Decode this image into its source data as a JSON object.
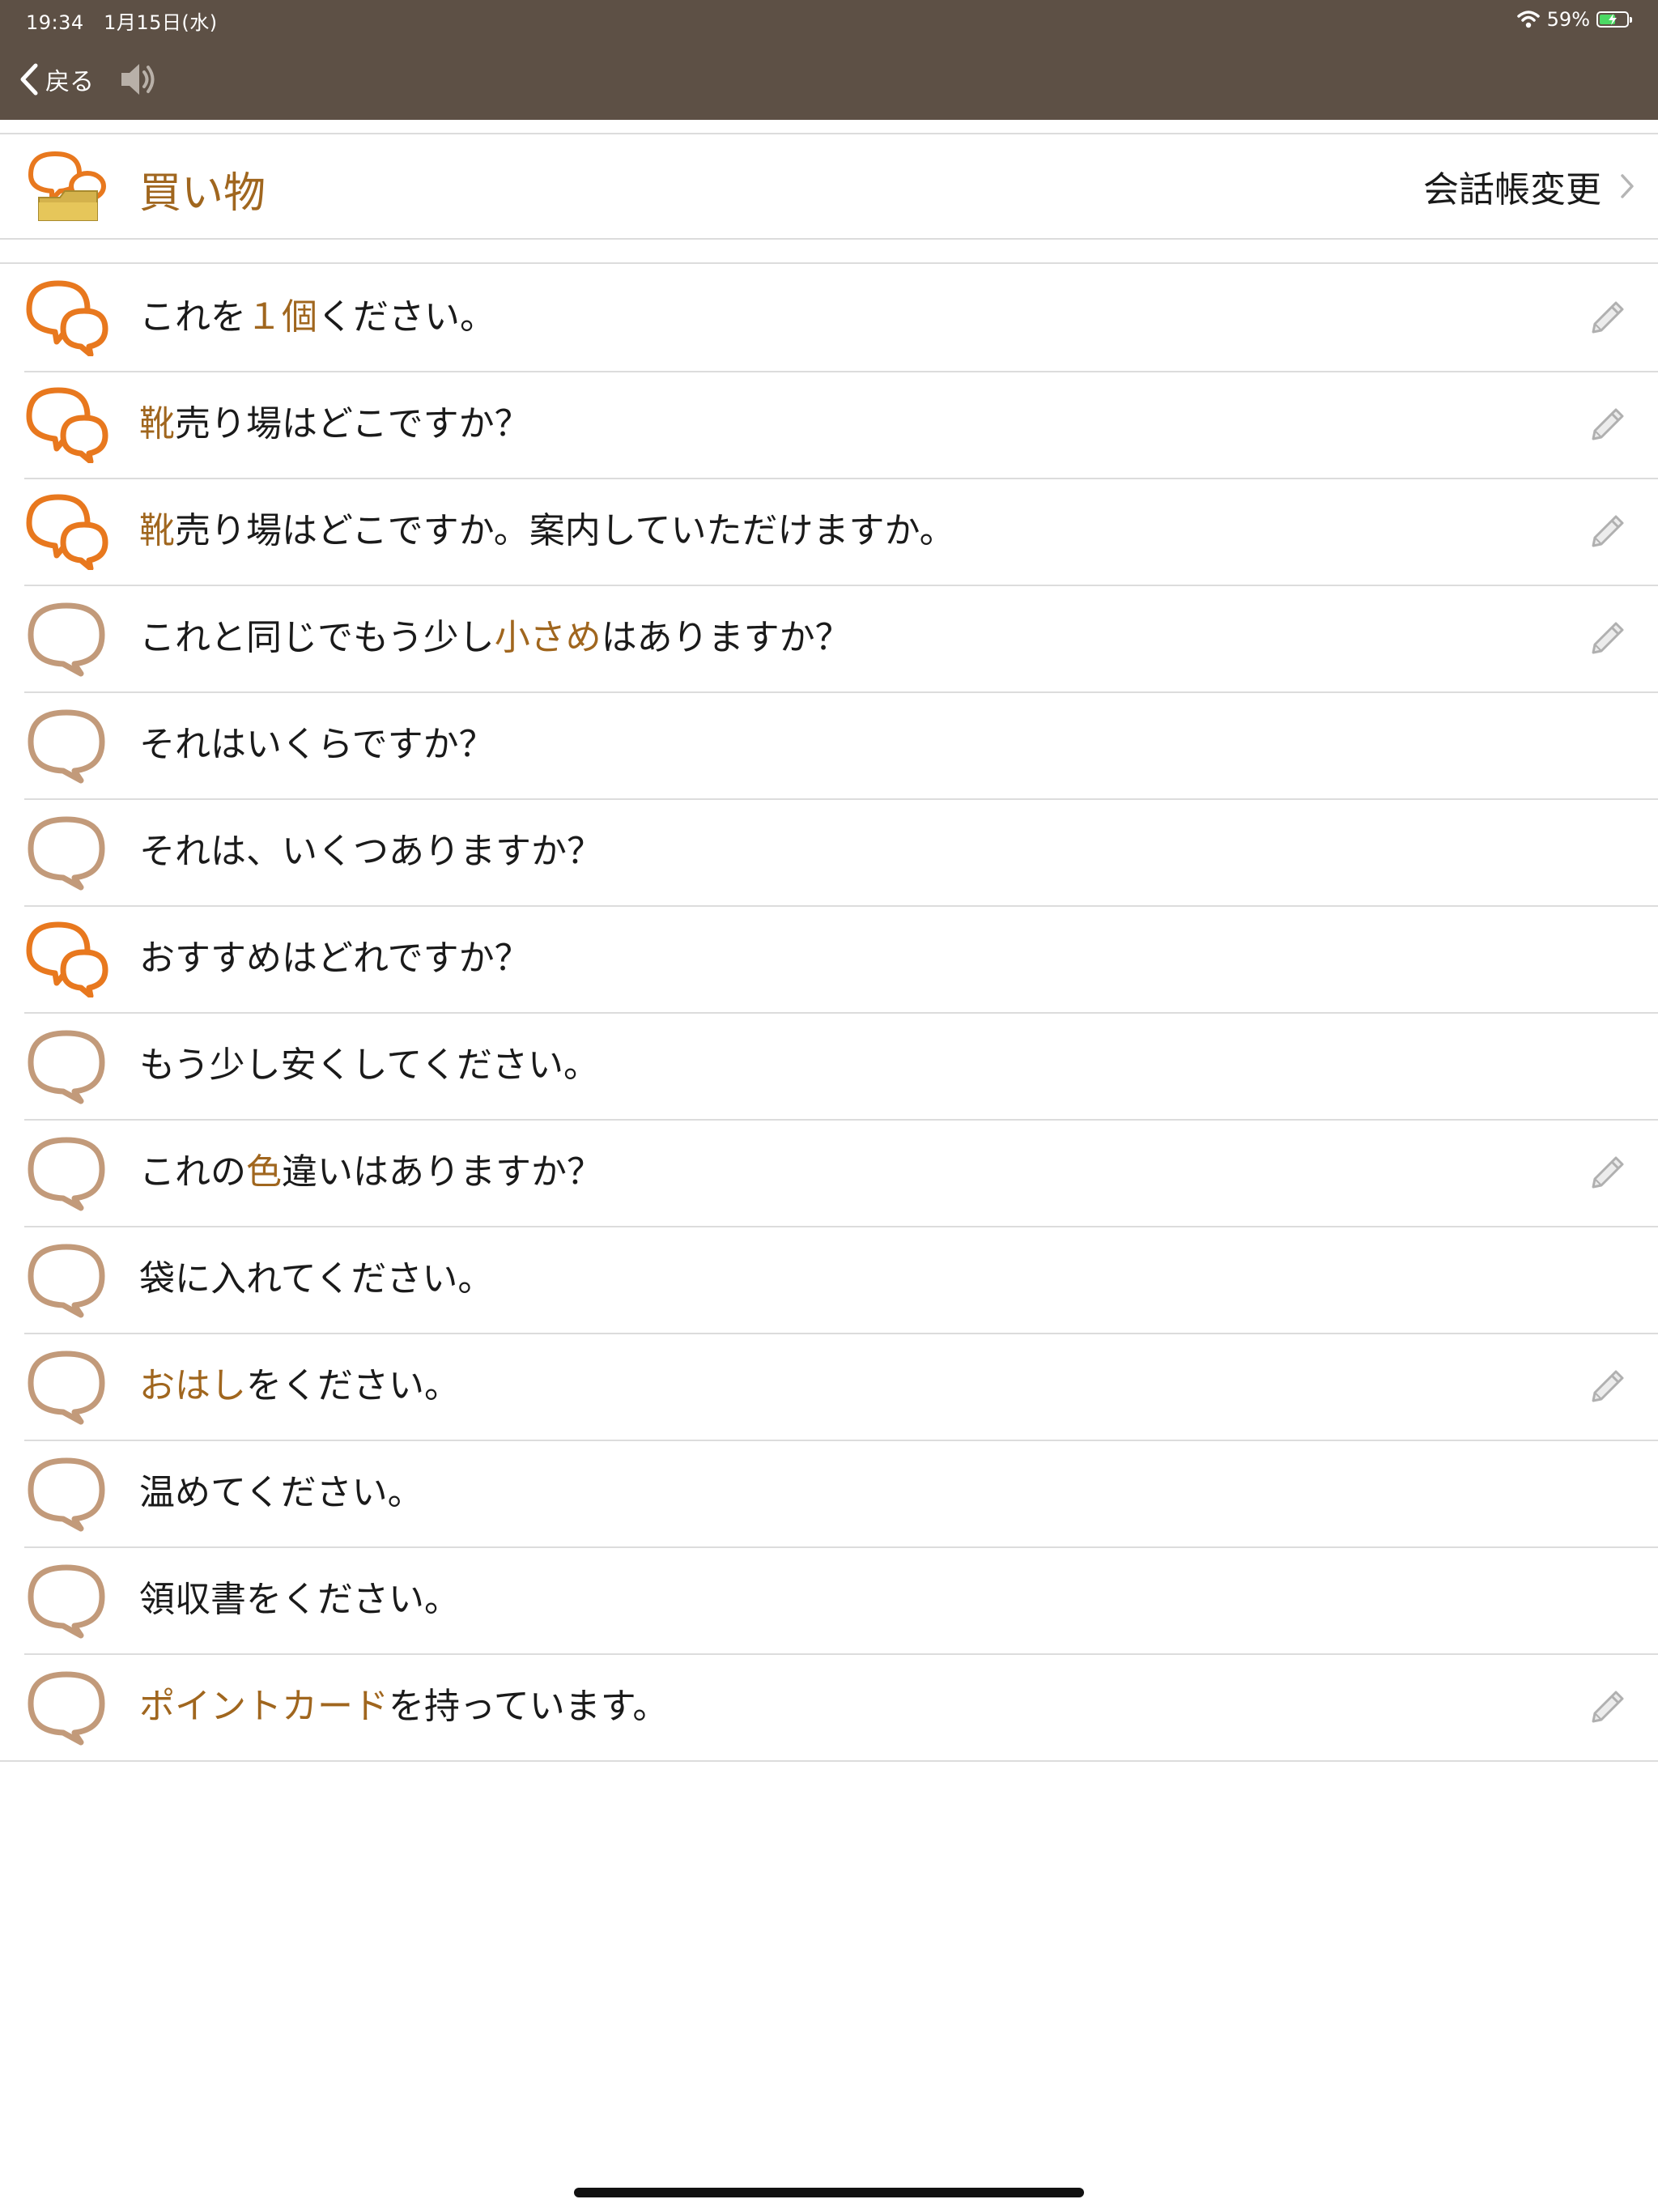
{
  "status": {
    "time": "19:34",
    "date": "1月15日(水)",
    "battery_text": "59%",
    "battery_level": 0.59,
    "wifi_icon": "wifi-icon",
    "battery_icon": "battery-charging-icon"
  },
  "nav": {
    "back_label": "戻る",
    "back_icon": "chevron-left-icon",
    "speaker_icon": "speaker-icon"
  },
  "category": {
    "title": "買い物",
    "icon": "folder-chat-icon",
    "change_label": "会話帳変更",
    "change_icon": "chevron-right-icon"
  },
  "colors": {
    "nav_bg": "#5d5045",
    "highlight": "#a0661e",
    "bubble_active": "#e8781e",
    "bubble_inactive": "#c29a7a",
    "divider": "#dcdcdc"
  },
  "phrases": [
    {
      "parts": [
        "これを",
        "１個",
        "ください。"
      ],
      "bubble": "double",
      "editable": true
    },
    {
      "parts": [
        "",
        "靴",
        "売り場はどこですか？"
      ],
      "bubble": "double",
      "editable": true
    },
    {
      "parts": [
        "",
        "靴",
        "売り場はどこですか。案内していただけますか。"
      ],
      "bubble": "double",
      "editable": true
    },
    {
      "parts": [
        "これと同じでもう少し",
        "小さめ",
        "はありますか？"
      ],
      "bubble": "single",
      "editable": true
    },
    {
      "parts": [
        "それはいくらですか？",
        "",
        ""
      ],
      "bubble": "single",
      "editable": false
    },
    {
      "parts": [
        "それは、いくつありますか？",
        "",
        ""
      ],
      "bubble": "single",
      "editable": false
    },
    {
      "parts": [
        "おすすめはどれですか？",
        "",
        ""
      ],
      "bubble": "double",
      "editable": false
    },
    {
      "parts": [
        "もう少し安くしてください。",
        "",
        ""
      ],
      "bubble": "single",
      "editable": false
    },
    {
      "parts": [
        "これの",
        "色",
        "違いはありますか？"
      ],
      "bubble": "single",
      "editable": true
    },
    {
      "parts": [
        "袋に入れてください。",
        "",
        ""
      ],
      "bubble": "single",
      "editable": false
    },
    {
      "parts": [
        "",
        "おはし",
        "をください。"
      ],
      "bubble": "single",
      "editable": true
    },
    {
      "parts": [
        "温めてください。",
        "",
        ""
      ],
      "bubble": "single",
      "editable": false
    },
    {
      "parts": [
        "領収書をください。",
        "",
        ""
      ],
      "bubble": "single",
      "editable": false
    },
    {
      "parts": [
        "",
        "ポイントカード",
        "を持っています。"
      ],
      "bubble": "single",
      "editable": true
    }
  ],
  "icons": {
    "bubble_single": "speech-bubble-icon",
    "bubble_double": "double-speech-bubble-icon",
    "edit": "pencil-icon"
  }
}
